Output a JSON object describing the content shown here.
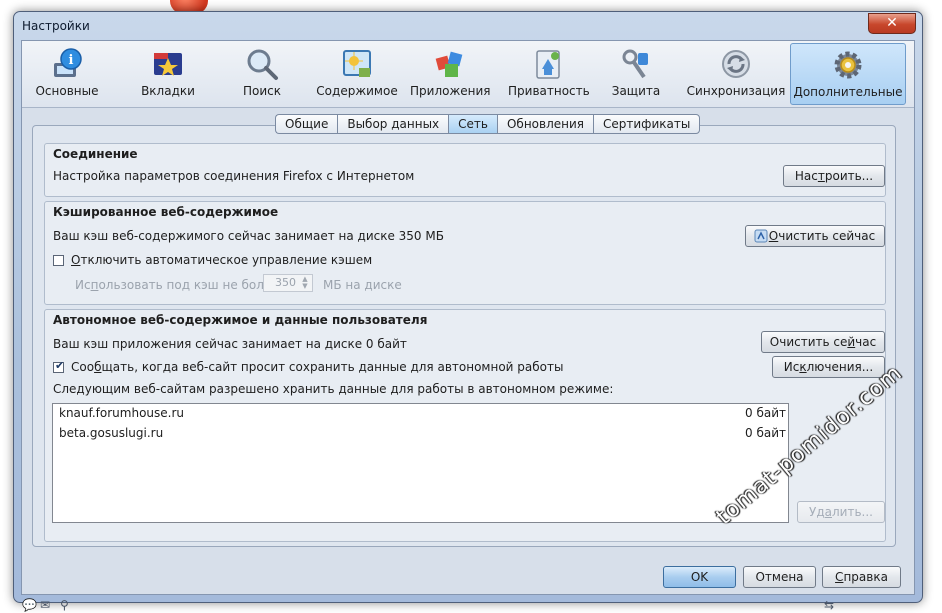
{
  "window": {
    "title": "Настройки",
    "close_glyph": "✕"
  },
  "toolbar": {
    "panes": [
      {
        "label": "Основные",
        "icon": "general-icon"
      },
      {
        "label": "Вкладки",
        "icon": "tabs-icon"
      },
      {
        "label": "Поиск",
        "icon": "search-icon"
      },
      {
        "label": "Содержимое",
        "icon": "content-icon"
      },
      {
        "label": "Приложения",
        "icon": "applications-icon"
      },
      {
        "label": "Приватность",
        "icon": "privacy-icon"
      },
      {
        "label": "Защита",
        "icon": "security-icon"
      },
      {
        "label": "Синхронизация",
        "icon": "sync-icon"
      },
      {
        "label": "Дополнительные",
        "icon": "advanced-icon",
        "selected": true
      }
    ]
  },
  "tabs": [
    {
      "label": "Общие"
    },
    {
      "label": "Выбор данных"
    },
    {
      "label": "Сеть",
      "selected": true
    },
    {
      "label": "Обновления"
    },
    {
      "label": "Сертификаты"
    }
  ],
  "connection": {
    "title": "Соединение",
    "description": "Настройка параметров соединения Firefox с Интернетом",
    "settings_button": {
      "pre": "Нас",
      "key": "т",
      "post": "роить..."
    }
  },
  "cache": {
    "title": "Кэшированное веб-содержимое",
    "usage_text": "Ваш кэш веб-содержимого сейчас занимает на диске 350 МБ",
    "clear_button": {
      "pre": "",
      "key": "О",
      "post": "чистить сейчас"
    },
    "override_checkbox": {
      "pre": "",
      "key": "О",
      "post": "тключить автоматическое управление кэшем",
      "checked": false
    },
    "limit_label": {
      "pre": "Ис",
      "key": "п",
      "post": "ользовать под кэш не более"
    },
    "limit_value": "350",
    "limit_unit": "МБ на диске"
  },
  "offline": {
    "title": "Автономное веб-содержимое и данные пользователя",
    "usage_text": "Ваш кэш приложения сейчас занимает на диске 0 байт",
    "clear_button": {
      "pre": "Очистить се",
      "key": "й",
      "post": "час"
    },
    "notify_checkbox": {
      "pre": "Соо",
      "key": "б",
      "post": "щать, когда веб-сайт просит сохранить данные для автономной работы",
      "checked": true
    },
    "exceptions_button": {
      "pre": "Ис",
      "key": "к",
      "post": "лючения..."
    },
    "allowed_label": "Следующим веб-сайтам разрешено хранить данные для работы в автономном режиме:",
    "sites": [
      {
        "host": "knauf.forumhouse.ru",
        "size": "0 байт"
      },
      {
        "host": "beta.gosuslugi.ru",
        "size": "0 байт"
      }
    ],
    "remove_button": {
      "pre": "Уд",
      "key": "а",
      "post": "лить..."
    }
  },
  "footer": {
    "ok": "OK",
    "cancel": "Отмена",
    "help": {
      "pre": "",
      "key": "С",
      "post": "правка"
    }
  },
  "watermark": "tomat-pomidor.com"
}
